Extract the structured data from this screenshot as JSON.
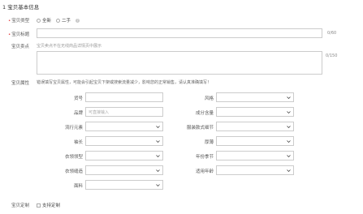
{
  "section": {
    "title": "1  宝贝基本信息"
  },
  "item_type": {
    "label": "宝贝类型",
    "options": [
      "全新",
      "二手"
    ]
  },
  "item_title": {
    "label": "宝贝标题",
    "counter": "0/60"
  },
  "item_selling_point": {
    "label": "宝贝卖点",
    "hint": "宝贝卖点不在无线商品详情页中展示",
    "counter": "0/150"
  },
  "item_attributes": {
    "label": "宝贝属性",
    "note": "错误填写宝贝属性，可能会引起宝贝下架或搜索流量减少，影响您的正常销售，请认真准确填写！",
    "left": [
      {
        "label": "货号"
      },
      {
        "label": "品牌",
        "placeholder": "可直接输入"
      },
      {
        "label": "流行元素"
      },
      {
        "label": "袖长"
      },
      {
        "label": "衣领领型"
      },
      {
        "label": "衣领缝造"
      },
      {
        "label": "面料"
      }
    ],
    "right": [
      {
        "label": "风格"
      },
      {
        "label": "成分含量"
      },
      {
        "label": "服装款式细节"
      },
      {
        "label": "厚薄"
      },
      {
        "label": "年份季节"
      },
      {
        "label": "适用年龄"
      }
    ]
  },
  "customization": {
    "label": "宝贝定制",
    "option": "支持定制"
  }
}
